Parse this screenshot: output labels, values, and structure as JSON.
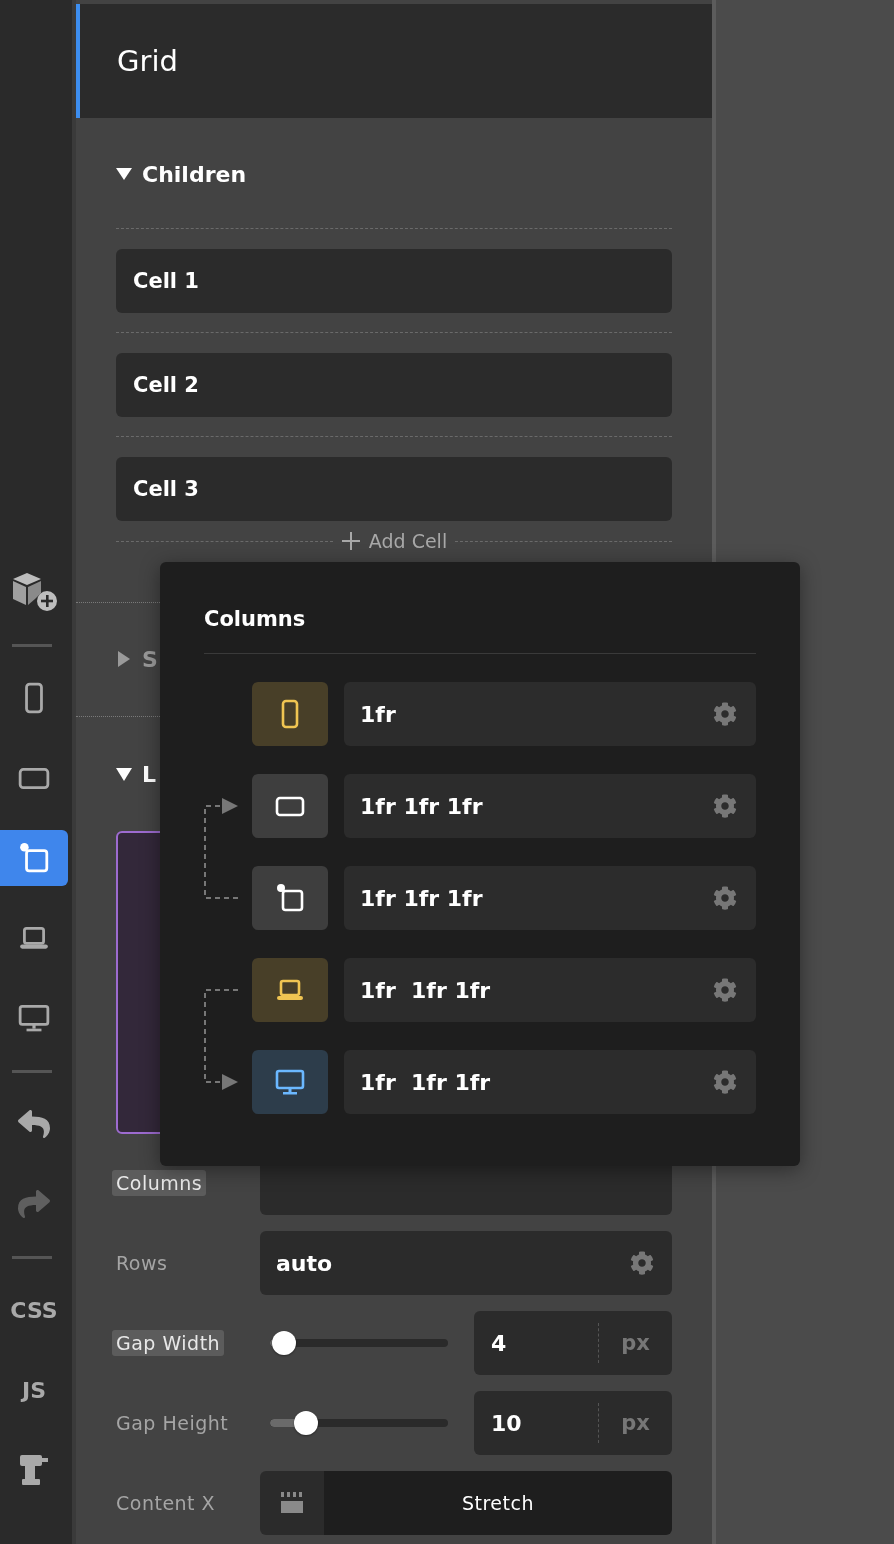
{
  "toolbar": [
    {
      "kind": "add"
    },
    {
      "kind": "divider"
    },
    {
      "kind": "portrait",
      "selected": false
    },
    {
      "kind": "landscape",
      "selected": false
    },
    {
      "kind": "rotate",
      "selected": true
    },
    {
      "kind": "laptop",
      "selected": false
    },
    {
      "kind": "desktop",
      "selected": false
    },
    {
      "kind": "divider"
    },
    {
      "kind": "undo",
      "disabled": false
    },
    {
      "kind": "redo",
      "disabled": true
    },
    {
      "kind": "divider"
    },
    {
      "kind": "text",
      "label": "CSS"
    },
    {
      "kind": "text",
      "label": "JS"
    },
    {
      "kind": "drill"
    }
  ],
  "panel": {
    "title": "Grid"
  },
  "children": {
    "title": "Children",
    "expanded": true,
    "items": [
      "Cell 1",
      "Cell 2",
      "Cell 3"
    ],
    "add_label": "Add Cell"
  },
  "sections": [
    {
      "title": "S",
      "expanded": false
    },
    {
      "title": "L",
      "expanded": true
    }
  ],
  "layout_rows": [
    {
      "kind": "covered",
      "label": "Columns",
      "highlighted": true
    },
    {
      "kind": "text",
      "label": "Rows",
      "value": "auto",
      "highlighted": false
    },
    {
      "kind": "slider",
      "label": "Gap Width",
      "highlighted": true,
      "level": 0.08,
      "value": "4",
      "unit": "px"
    },
    {
      "kind": "slider",
      "label": "Gap Height",
      "highlighted": false,
      "level": 0.2,
      "value": "10",
      "unit": "px"
    },
    {
      "kind": "select",
      "label": "Content X",
      "highlighted": false,
      "value": "Stretch"
    }
  ],
  "popover": {
    "title": "Columns",
    "rows": [
      {
        "kind": "portrait",
        "value": "1fr",
        "color": "#f0c552",
        "linked_below": false,
        "linked_above": false
      },
      {
        "kind": "landscape",
        "value": "1fr 1fr 1fr",
        "color": "#ffffff",
        "linked_below": true,
        "linked_above": false
      },
      {
        "kind": "rotate",
        "value": "1fr 1fr 1fr",
        "color": "#ffffff",
        "linked_below": false,
        "linked_above": false
      },
      {
        "kind": "laptop",
        "value": "1fr  1fr 1fr",
        "color": "#f0c552",
        "linked_below": false,
        "linked_above": false
      },
      {
        "kind": "desktop",
        "value": "1fr  1fr 1fr",
        "color": "#6bb8ff",
        "linked_below": false,
        "linked_above": true
      }
    ]
  }
}
